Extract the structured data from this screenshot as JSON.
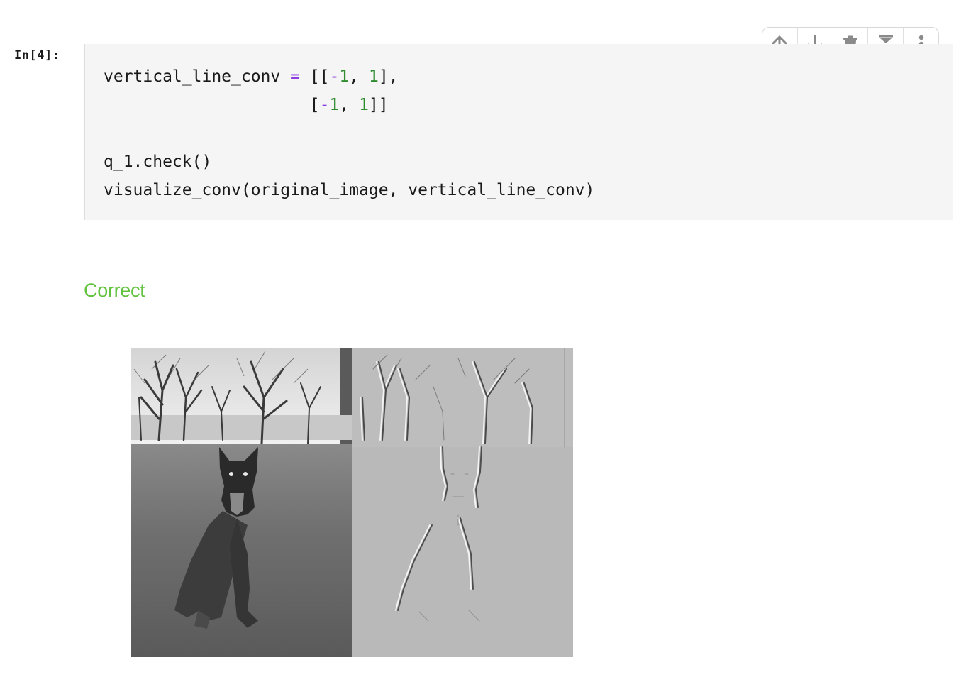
{
  "cell": {
    "prompt": "In[4]:",
    "code": {
      "line1": {
        "name": "vertical_line_conv",
        "eq": "=",
        "open": "[[",
        "neg": "-1",
        "sep": ",",
        "pos": "1",
        "close": "],"
      },
      "line2": {
        "open": "[",
        "neg": "-1",
        "sep": ",",
        "pos": "1",
        "close": "]]"
      },
      "line4": "q_1.check()",
      "line5": "visualize_conv(original_image, vertical_line_conv)"
    }
  },
  "toolbar": {
    "buttons": [
      {
        "icon": "arrow-up-icon"
      },
      {
        "icon": "arrow-down-icon"
      },
      {
        "icon": "trash-icon"
      },
      {
        "icon": "collapse-icon"
      },
      {
        "icon": "more-vertical-icon"
      }
    ]
  },
  "output": {
    "result_text": "Correct",
    "result_color": "#62c23e"
  },
  "colors": {
    "operator": "#8a3ee0",
    "number": "#2e8b2e",
    "cell_background": "#f5f5f5"
  }
}
